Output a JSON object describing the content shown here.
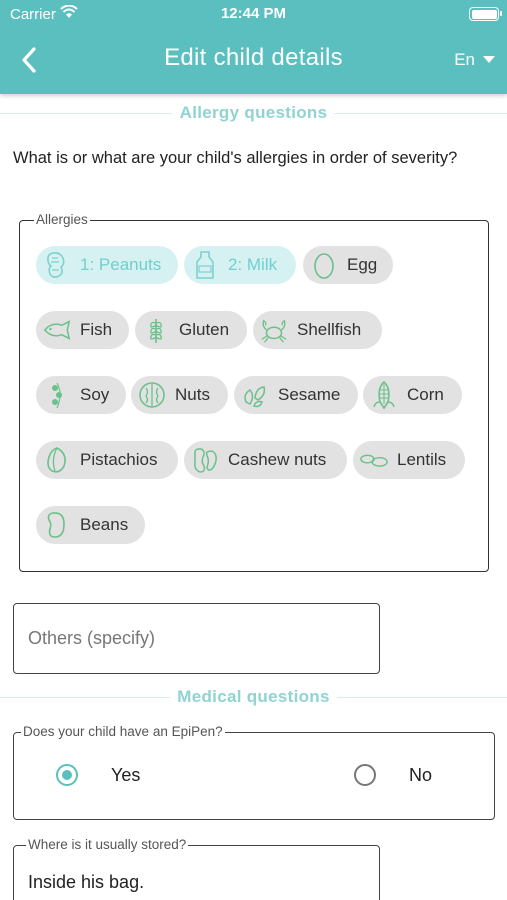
{
  "status_bar": {
    "carrier": "Carrier",
    "time": "12:44 PM"
  },
  "header": {
    "title": "Edit child details",
    "language": "En"
  },
  "sections": {
    "allergy": "Allergy questions",
    "medical": "Medical questions"
  },
  "allergy_question": "What is or what are your child's allergies in order of severity?",
  "allergies": {
    "legend": "Allergies",
    "chips": [
      {
        "label": "1: Peanuts",
        "icon": "peanut-icon",
        "selected": true
      },
      {
        "label": "2: Milk",
        "icon": "milk-bottle-icon",
        "selected": true
      },
      {
        "label": "Egg",
        "icon": "egg-icon",
        "selected": false
      },
      {
        "label": "Fish",
        "icon": "fish-icon",
        "selected": false
      },
      {
        "label": "Gluten",
        "icon": "wheat-icon",
        "selected": false
      },
      {
        "label": "Shellfish",
        "icon": "crab-icon",
        "selected": false
      },
      {
        "label": "Soy",
        "icon": "soy-icon",
        "selected": false
      },
      {
        "label": "Nuts",
        "icon": "walnut-icon",
        "selected": false
      },
      {
        "label": "Sesame",
        "icon": "sesame-icon",
        "selected": false
      },
      {
        "label": "Corn",
        "icon": "corn-icon",
        "selected": false
      },
      {
        "label": "Pistachios",
        "icon": "pistachio-icon",
        "selected": false
      },
      {
        "label": "Cashew nuts",
        "icon": "cashew-icon",
        "selected": false
      },
      {
        "label": "Lentils",
        "icon": "lentil-icon",
        "selected": false
      },
      {
        "label": "Beans",
        "icon": "bean-icon",
        "selected": false
      }
    ]
  },
  "others": {
    "placeholder": "Others (specify)",
    "value": ""
  },
  "epipen": {
    "legend": "Does your child have an EpiPen?",
    "yes": "Yes",
    "no": "No",
    "selected": "Yes"
  },
  "storage": {
    "legend": "Where is it usually stored?",
    "value": "Inside his bag."
  },
  "colors": {
    "accent": "#5bbfc0",
    "selected_chip": "#d6f1f1",
    "chip": "#e2e2e2",
    "icon_green": "#6cc08b"
  }
}
